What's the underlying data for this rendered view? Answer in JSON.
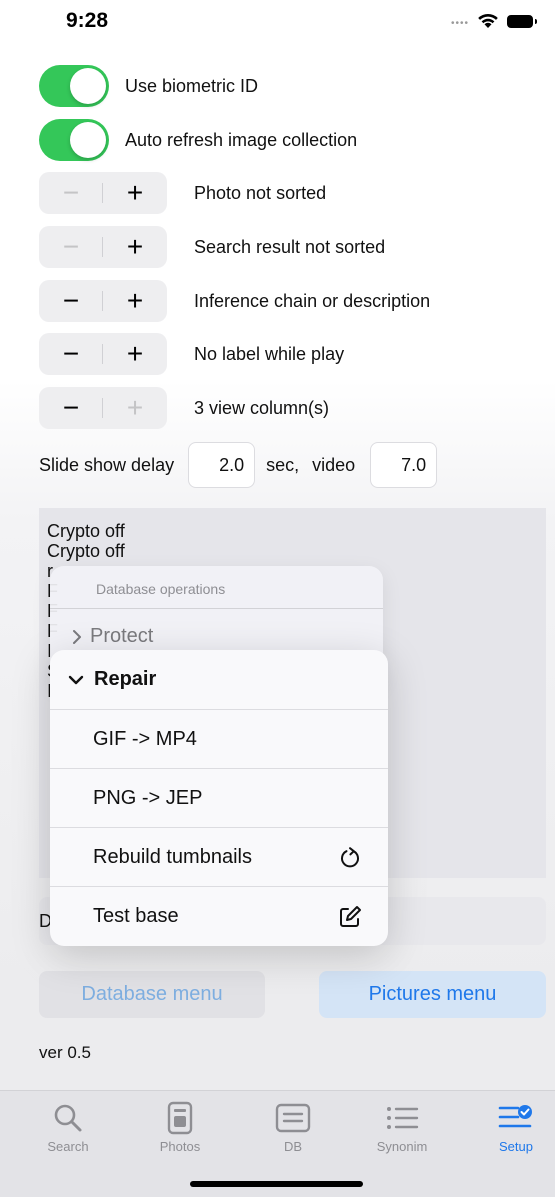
{
  "status": {
    "time": "9:28"
  },
  "settings": {
    "toggles": [
      {
        "label": "Use biometric ID",
        "on": true
      },
      {
        "label": "Auto refresh image collection",
        "on": true
      }
    ],
    "steppers": [
      {
        "label": "Photo not sorted",
        "minus": "−",
        "plus": "+"
      },
      {
        "label": "Search result not sorted",
        "minus": "−",
        "plus": "+"
      },
      {
        "label": "Inference chain or description",
        "minus": "−",
        "plus": "+"
      },
      {
        "label": "No label while play",
        "minus": "−",
        "plus": "+"
      },
      {
        "label": "3 view column(s)",
        "minus": "−",
        "plus": "+"
      }
    ],
    "delay": {
      "label": "Slide show delay",
      "value": "2.0",
      "sec_label": "sec,",
      "video_label": "video",
      "video_value": "7.0"
    }
  },
  "log": {
    "lines": [
      "Crypto off",
      "Crypto off",
      "r",
      "F",
      "F",
      "F",
      "I",
      "S",
      "I"
    ]
  },
  "db_field_text": "D",
  "buttons": {
    "database_menu": "Database menu",
    "pictures_menu": "Pictures menu"
  },
  "version": "ver 0.5",
  "context_menu": {
    "header": "Database operations",
    "protect_label": "Protect",
    "repair_label": "Repair",
    "items": [
      {
        "label": "GIF -> MP4",
        "icon": ""
      },
      {
        "label": "PNG -> JEP",
        "icon": ""
      },
      {
        "label": "Rebuild tumbnails",
        "icon": "rotate-icon"
      },
      {
        "label": "Test base",
        "icon": "compose-icon"
      }
    ]
  },
  "tabbar": {
    "tabs": [
      {
        "label": "Search",
        "icon": "magnifier-icon",
        "active": false
      },
      {
        "label": "Photos",
        "icon": "photos-icon",
        "active": false
      },
      {
        "label": "DB",
        "icon": "db-icon",
        "active": false
      },
      {
        "label": "Synonim",
        "icon": "list-icon",
        "active": false
      },
      {
        "label": "Setup",
        "icon": "setup-icon",
        "active": true
      }
    ],
    "accent_color": "#1f78ea"
  }
}
